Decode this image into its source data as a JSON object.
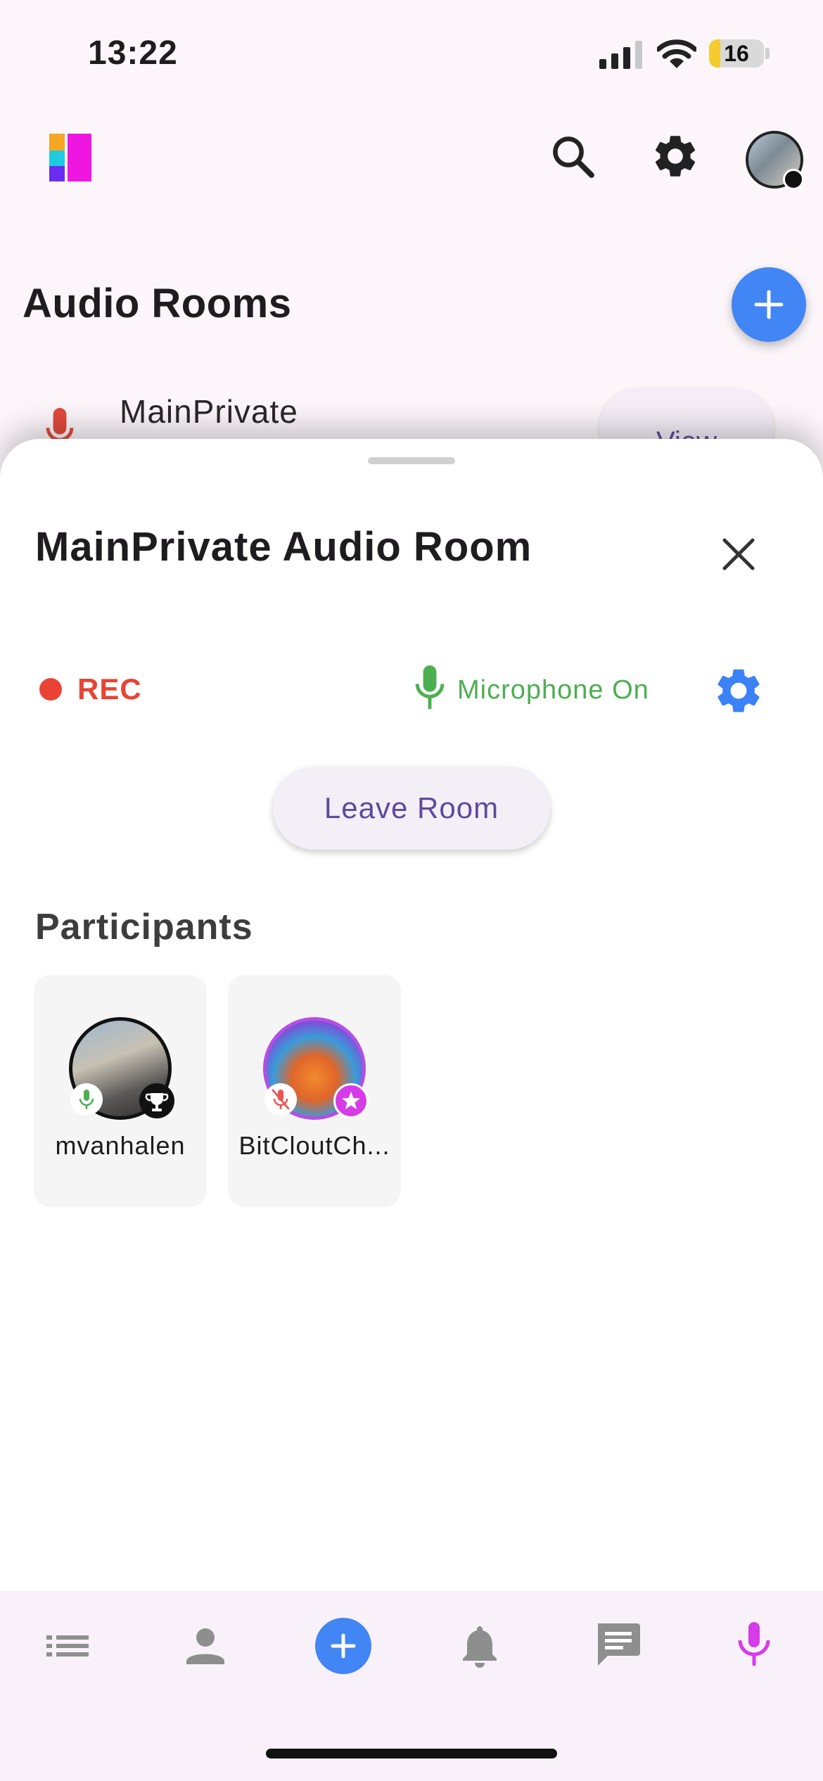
{
  "status_bar": {
    "time": "13:22",
    "battery": "16",
    "battery_level_percent": 16,
    "icons": [
      "cellular-signal-icon",
      "wifi-icon",
      "battery-icon"
    ]
  },
  "header": {
    "icons": [
      "app-logo",
      "search-icon",
      "settings-gear-icon",
      "profile-avatar"
    ]
  },
  "page": {
    "title": "Audio Rooms",
    "room_row": {
      "name": "MainPrivate",
      "view_label": "View"
    }
  },
  "sheet": {
    "title": "MainPrivate Audio Room",
    "rec_label": "REC",
    "microphone_label": "Microphone On",
    "leave_label": "Leave Room",
    "participants_heading": "Participants",
    "participants": [
      {
        "name": "mvanhalen",
        "mic": "on",
        "badge": "trophy-icon"
      },
      {
        "name": "BitCloutCh...",
        "mic": "muted",
        "badge": "star-icon"
      }
    ]
  },
  "colors": {
    "accent_blue": "#4285f4",
    "record_red": "#ea4335",
    "mic_green": "#4caf50",
    "nav_active_magenta": "#d63be8",
    "button_text_purple": "#5b4a9e"
  },
  "bottom_nav": {
    "items": [
      "feed-list-icon",
      "profile-icon",
      "create-post-icon",
      "notifications-bell-icon",
      "messages-icon",
      "audio-mic-icon"
    ],
    "active": "audio-mic-icon"
  }
}
